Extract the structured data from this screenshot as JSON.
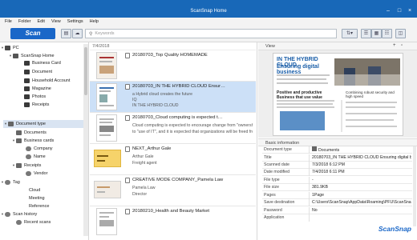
{
  "app": {
    "title": "ScanSnap Home",
    "logo": "ScanSnap"
  },
  "menu": [
    "File",
    "Folder",
    "Edit",
    "View",
    "Settings",
    "Help"
  ],
  "toolbar": {
    "scan_label": "Scan",
    "search_placeholder": "Keywords"
  },
  "sidebar": {
    "pc": "PC",
    "home": "ScanSnap Home",
    "folders": [
      "Business Card",
      "Document",
      "Household Account",
      "Magazine",
      "Photos",
      "Receipts"
    ],
    "doc_type": "Document type",
    "documents": "Documents",
    "business_cards": "Business cards",
    "company": "Company",
    "name": "Name",
    "receipts": "Receipts",
    "vendor": "Vendor",
    "tag": "Tag",
    "tags": [
      "Cloud",
      "Meeting",
      "Reference"
    ],
    "scan_history": "Scan history",
    "recent": "Recent scans"
  },
  "list": {
    "date_header": "7/4/2018",
    "items": [
      {
        "name": "20180703_Top Quality HOMEMADE",
        "lines": []
      },
      {
        "name": "20180703_IN THE HYBRID CLOUD Ensur…",
        "lines": [
          "a Hybrid cloud creates the future",
          "IQ",
          "IN THE HYBRID CLOUD"
        ]
      },
      {
        "name": "20180703_Cloud computing is expected t…",
        "lines": [
          "Cloud computing is expected to encourage change from \"ownership of IT\"",
          "to \"use of IT\", and it is expected that organizations will be freed from…"
        ]
      },
      {
        "name": "NEXT_Arthur Gale",
        "lines": [
          "Arthur Gale",
          "Freight agent"
        ]
      },
      {
        "name": "CREATIVE MODE COMPANY_Pamela Law",
        "lines": [
          "Pamela Law",
          "Director"
        ]
      },
      {
        "name": "20180210_Health and Beauty Market",
        "lines": []
      }
    ]
  },
  "viewer": {
    "header": "View",
    "page_title": "IN THE HYBRID CLOUD",
    "page_subtitle": "Ensuring digital business",
    "sec1": "Positive and productive Business that use value",
    "sec2": "Combining robust security and high speed"
  },
  "info": {
    "header": "Basic information",
    "rows": [
      {
        "k": "Document type",
        "v": "Documents"
      },
      {
        "k": "Title",
        "v": "20180703_IN THE HYBRID CLOUD Ensuring digital b"
      },
      {
        "k": "Scanned date",
        "v": "7/3/2018 6:12 PM"
      },
      {
        "k": "Date modified",
        "v": "7/4/2018 6:11 PM"
      },
      {
        "k": "File type",
        "v": "-"
      },
      {
        "k": "File size",
        "v": "381.9KB"
      },
      {
        "k": "Pages",
        "v": "1Page"
      },
      {
        "k": "Save destination",
        "v": "C:\\Users\\ScanSnap\\AppData\\Roaming\\PFU\\ScanSnap"
      },
      {
        "k": "Password",
        "v": "No"
      },
      {
        "k": "Application",
        "v": ""
      }
    ]
  },
  "colors": {
    "accent": "#1868b8",
    "selected": "#cce0f7"
  }
}
